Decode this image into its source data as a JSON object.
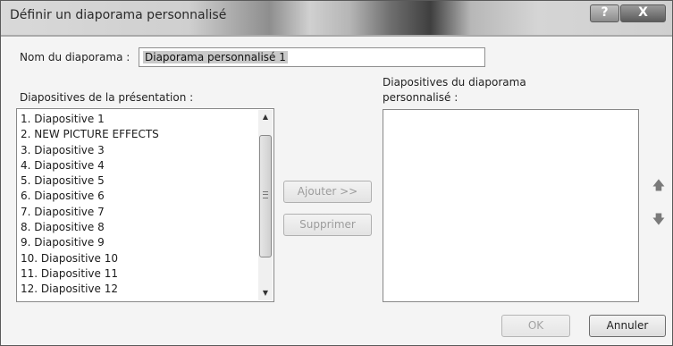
{
  "window": {
    "title": "Définir un diaporama personnalisé",
    "help_glyph": "?",
    "close_glyph": "X"
  },
  "name_field": {
    "label": "Nom du diaporama :",
    "value": "Diaporama personnalisé 1"
  },
  "left_list": {
    "label": "Diapositives de la présentation :",
    "items": [
      "1. Diapositive 1",
      "2. NEW PICTURE EFFECTS",
      "3. Diapositive 3",
      "4. Diapositive 4",
      "5. Diapositive 5",
      "6. Diapositive 6",
      "7. Diapositive 7",
      "8. Diapositive 8",
      "9. Diapositive 9",
      "10. Diapositive 10",
      "11. Diapositive 11",
      "12. Diapositive 12"
    ]
  },
  "middle_buttons": {
    "add_label": "Ajouter >>",
    "remove_label": "Supprimer"
  },
  "right_list": {
    "label_line1": "Diapositives du diaporama",
    "label_line2": "personnalisé :",
    "items": []
  },
  "move_buttons": {
    "up_icon": "arrow-up-icon",
    "down_icon": "arrow-down-icon"
  },
  "footer": {
    "ok_label": "OK",
    "cancel_label": "Annuler"
  }
}
